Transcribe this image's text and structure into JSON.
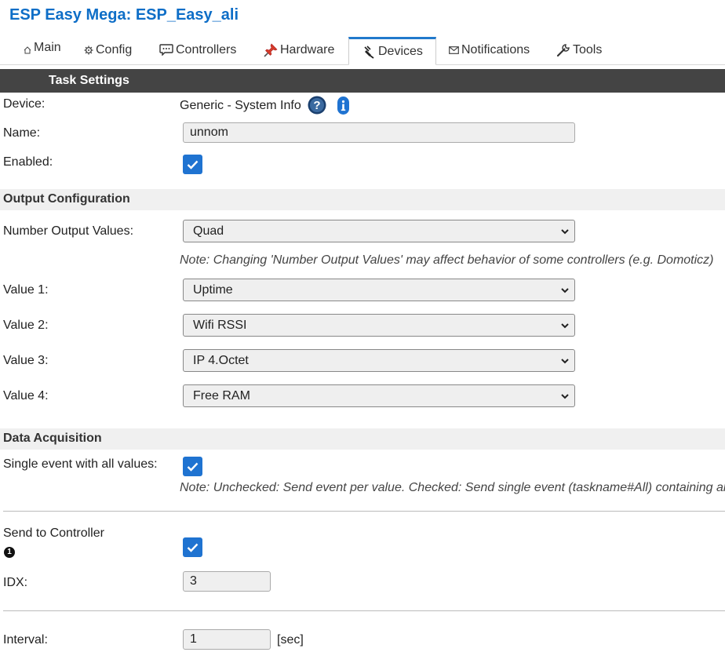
{
  "app": {
    "title": "ESP Easy Mega: ESP_Easy_ali"
  },
  "tabs": [
    {
      "label": "Main",
      "icon": "home-icon"
    },
    {
      "label": "Config",
      "icon": "gear-icon"
    },
    {
      "label": "Controllers",
      "icon": "chat-bubble-icon"
    },
    {
      "label": "Hardware",
      "icon": "pushpin-icon"
    },
    {
      "label": "Devices",
      "icon": "plug-icon",
      "active": true
    },
    {
      "label": "Notifications",
      "icon": "envelope-icon"
    },
    {
      "label": "Tools",
      "icon": "wrench-icon"
    }
  ],
  "task_settings": {
    "header": "Task Settings",
    "device_label": "Device:",
    "device_value": "Generic - System Info",
    "name_label": "Name:",
    "name_value": "unnom",
    "enabled_label": "Enabled:",
    "enabled": true
  },
  "output_config": {
    "header": "Output Configuration",
    "num_values_label": "Number Output Values:",
    "num_values_selected": "Quad",
    "note": "Note: Changing 'Number Output Values' may affect behavior of some controllers (e.g. Domoticz)",
    "values": [
      {
        "label": "Value 1:",
        "selected": "Uptime"
      },
      {
        "label": "Value 2:",
        "selected": "Wifi RSSI"
      },
      {
        "label": "Value 3:",
        "selected": "IP 4.Octet"
      },
      {
        "label": "Value 4:",
        "selected": "Free RAM"
      }
    ]
  },
  "data_acquisition": {
    "header": "Data Acquisition",
    "single_event_label": "Single event with all values:",
    "single_event": true,
    "single_event_note": "Note: Unchecked: Send event per value. Checked: Send single event (taskname#All) containing all",
    "send_controller_label": "Send to Controller",
    "controller_number": "1",
    "send_controller": true,
    "idx_label": "IDX:",
    "idx_value": "3",
    "interval_label": "Interval:",
    "interval_value": "1",
    "interval_unit": "[sec]"
  },
  "colors": {
    "accent": "#1f73d1",
    "title": "#0e6ec7",
    "header_bg": "#444444",
    "subhead_bg": "#f0f0f0"
  }
}
